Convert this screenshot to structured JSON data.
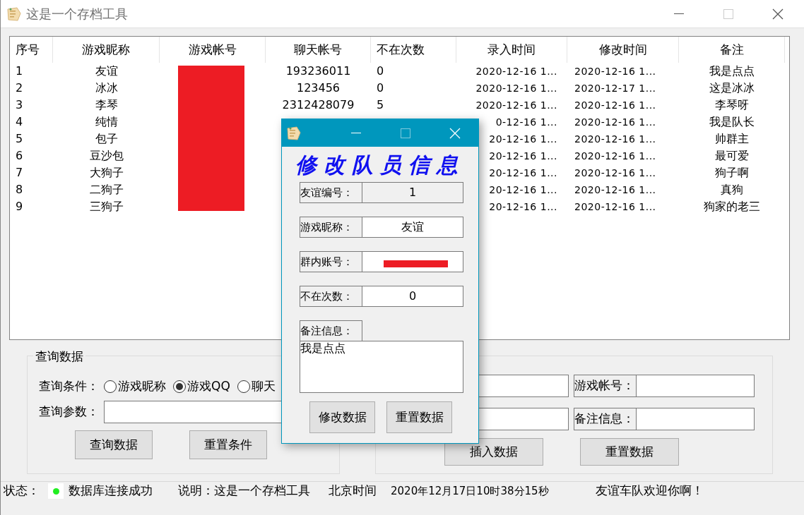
{
  "window": {
    "title": "这是一个存档工具"
  },
  "table": {
    "columns": [
      "序号",
      "游戏昵称",
      "游戏帐号",
      "聊天帐号",
      "不在次数",
      "录入时间",
      "修改时间",
      "备注"
    ],
    "rows": [
      {
        "index": "1",
        "nickname": "友谊",
        "chat_account": "193236011",
        "absent_count": "0",
        "created": "2020-12-16 1...",
        "modified": "2020-12-16 1...",
        "note": "我是点点"
      },
      {
        "index": "2",
        "nickname": "冰冰",
        "chat_account": "123456",
        "absent_count": "0",
        "created": "2020-12-16 1...",
        "modified": "2020-12-17 1...",
        "note": "这是冰冰"
      },
      {
        "index": "3",
        "nickname": "李琴",
        "chat_account": "2312428079",
        "absent_count": "5",
        "created": "2020-12-16 1...",
        "modified": "2020-12-16 1...",
        "note": "李琴呀"
      },
      {
        "index": "4",
        "nickname": "纯情",
        "created": "0-12-16 1...",
        "modified": "2020-12-16 1...",
        "note": "我是队长"
      },
      {
        "index": "5",
        "nickname": "包子",
        "created": "20-12-16 1...",
        "modified": "2020-12-16 1...",
        "note": "帅群主"
      },
      {
        "index": "6",
        "nickname": "豆沙包",
        "created": "20-12-16 1...",
        "modified": "2020-12-16 1...",
        "note": "最可爱"
      },
      {
        "index": "7",
        "nickname": "大狗子",
        "created": "20-12-16 1...",
        "modified": "2020-12-16 1...",
        "note": "狗子啊"
      },
      {
        "index": "8",
        "nickname": "二狗子",
        "created": "20-12-16 1...",
        "modified": "2020-12-16 1...",
        "note": "真狗"
      },
      {
        "index": "9",
        "nickname": "三狗子",
        "created": "20-12-16 1...",
        "modified": "2020-12-16 1...",
        "note": "狗家的老三"
      }
    ]
  },
  "query_panel": {
    "title": "查询数据",
    "condition_label": "查询条件：",
    "options": [
      {
        "label": "游戏昵称",
        "selected": false
      },
      {
        "label": "游戏QQ",
        "selected": true
      },
      {
        "label": "聊天",
        "selected": false
      }
    ],
    "param_label": "查询参数：",
    "buttons": [
      "查询数据",
      "重置条件"
    ]
  },
  "insert_panel": {
    "fields": [
      {
        "label": "游戏帐号："
      },
      {
        "label": "备注信息："
      }
    ],
    "buttons": [
      "插入数据",
      "重置数据"
    ]
  },
  "status_bar": {
    "status_label": "状态：",
    "connected": true,
    "status_text": "数据库连接成功",
    "description": "说明：这是一个存档工具",
    "time_label": "北京时间",
    "time": "2020年12月17日10时38分15秒",
    "message": "友谊车队欢迎你啊！"
  },
  "dialog": {
    "heading": "修改队员信息",
    "fields": [
      {
        "label": "友谊编号：",
        "value": "1",
        "disabled": true
      },
      {
        "label": "游戏昵称：",
        "value": "友谊",
        "disabled": false
      },
      {
        "label": "群内账号：",
        "disabled": false,
        "redacted": true
      },
      {
        "label": "不在次数：",
        "value": "0",
        "disabled": false
      }
    ],
    "notes_label": "备注信息：",
    "notes": "我是点点",
    "buttons": [
      "修改数据",
      "重置数据"
    ]
  }
}
